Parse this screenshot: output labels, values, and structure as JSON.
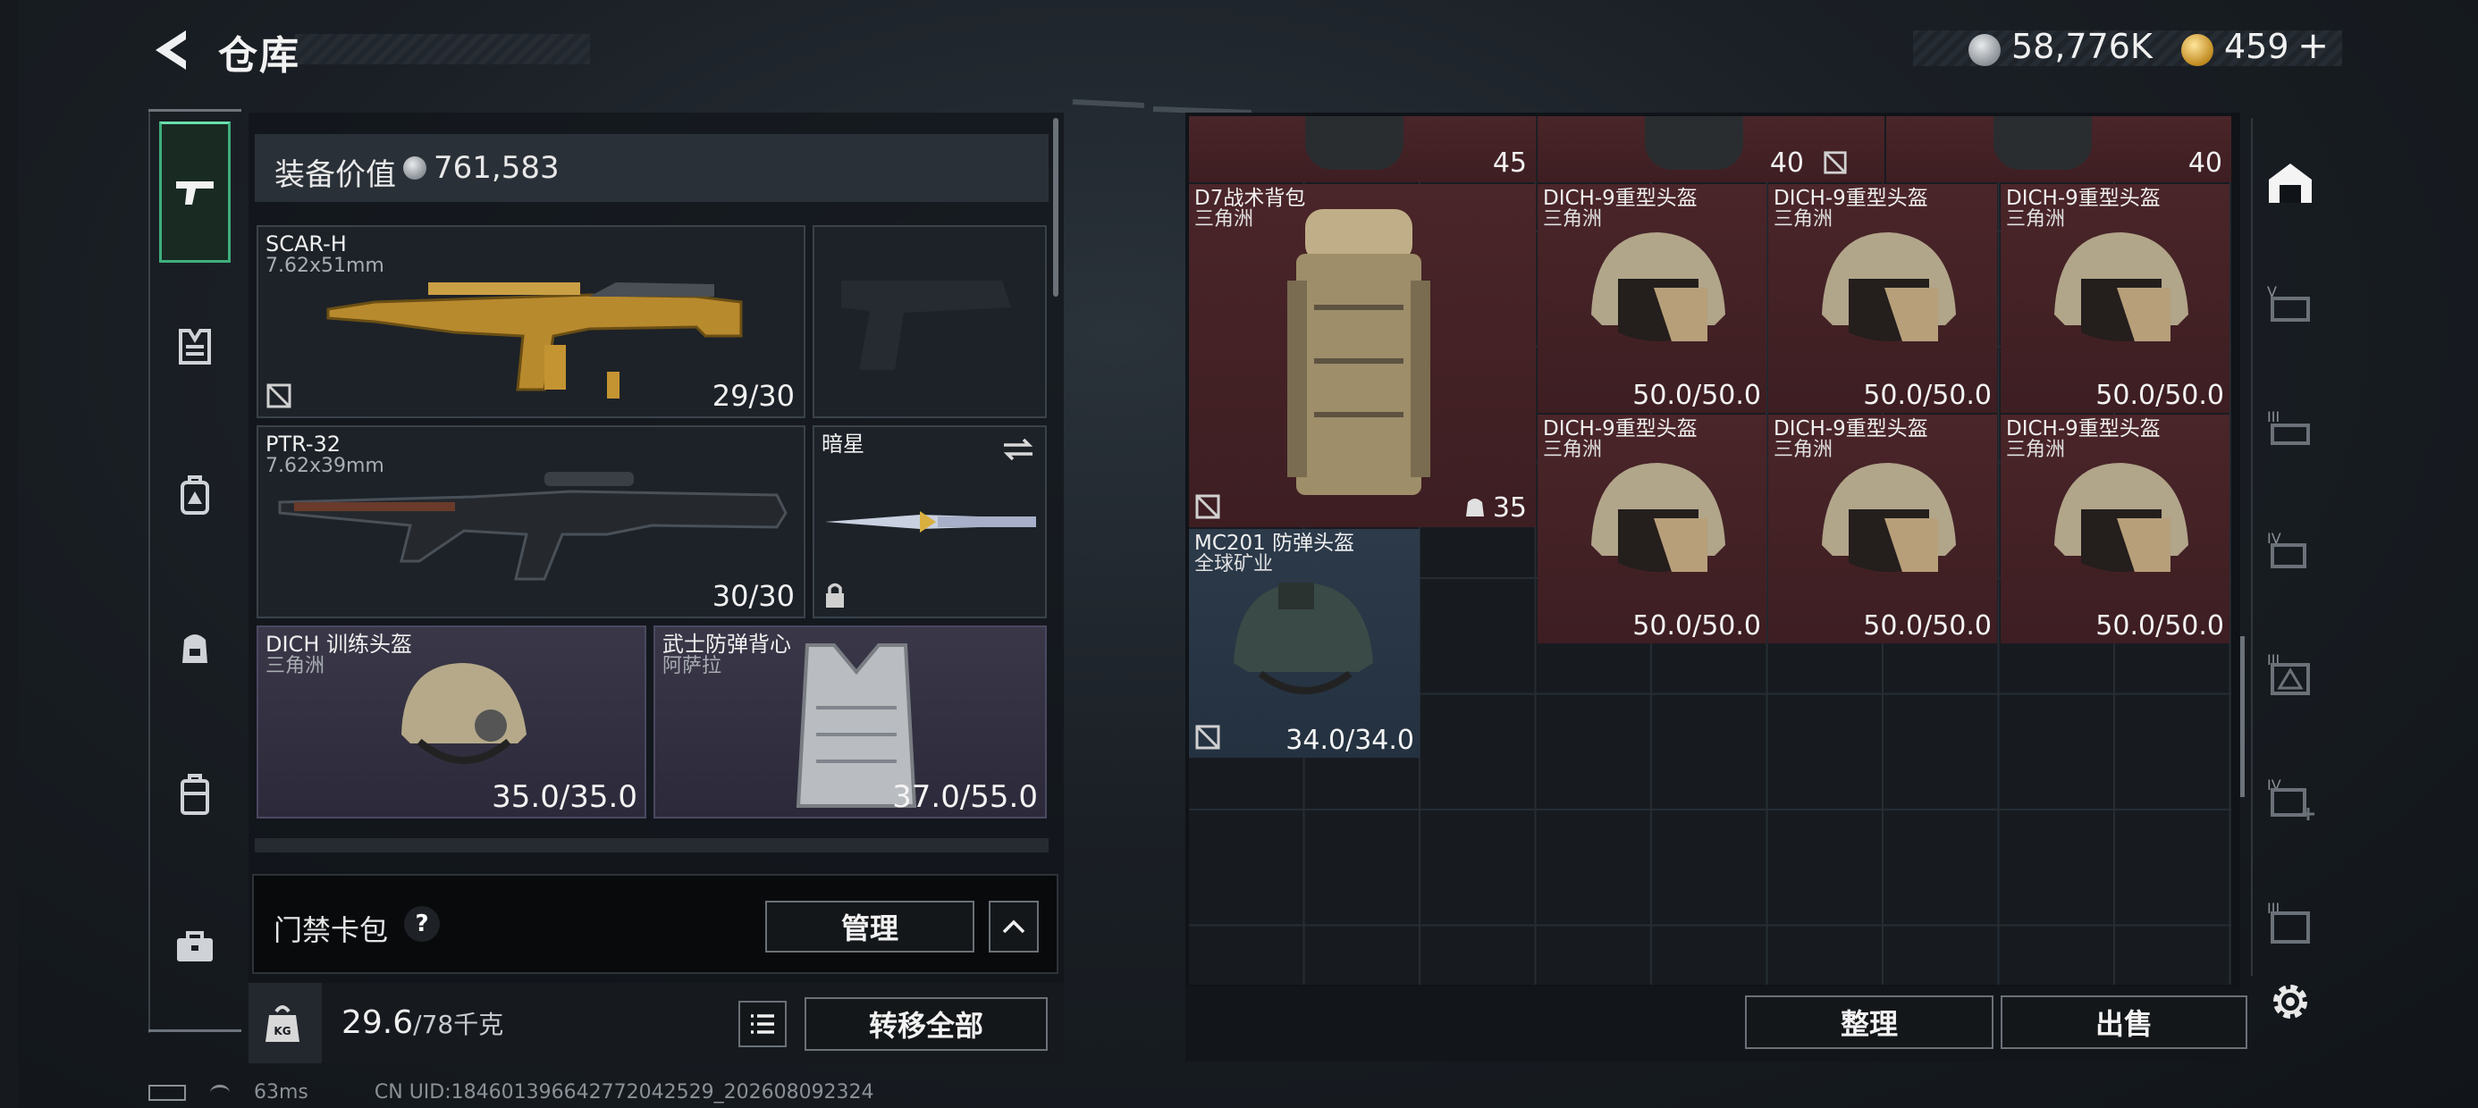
{
  "header": {
    "title": "仓库",
    "silver_amount": "58,776K",
    "gold_amount": "459",
    "gold_plus": "+"
  },
  "equipment": {
    "value_label": "装备价值",
    "value": "761,583",
    "primary_weapon": {
      "name": "SCAR-H",
      "caliber": "7.62x51mm",
      "ammo": "29/30"
    },
    "sidearm": {
      "name": "",
      "caliber": ""
    },
    "secondary_weapon": {
      "name": "PTR-32",
      "caliber": "7.62x39mm",
      "ammo": "30/30"
    },
    "melee": {
      "name": "暗星"
    },
    "helmet": {
      "name": "DICH 训练头盔",
      "sub": "三角洲",
      "durability": "35.0/35.0"
    },
    "armor": {
      "name": "武士防弹背心",
      "sub": "阿萨拉",
      "durability": "37.0/55.0"
    }
  },
  "keycard": {
    "label": "门禁卡包",
    "help": "?",
    "manage_label": "管理"
  },
  "footer_left": {
    "weight": "29.6",
    "weight_max": "/78千克",
    "transfer_all_label": "转移全部"
  },
  "stash": {
    "top_row_caps": [
      "45",
      "40",
      "40"
    ],
    "backpack": {
      "name": "D7战术背包",
      "sub": "三角洲",
      "capacity": "35"
    },
    "heavy_helmets": [
      {
        "name": "DICH-9重型头盔",
        "sub": "三角洲",
        "durability": "50.0/50.0"
      },
      {
        "name": "DICH-9重型头盔",
        "sub": "三角洲",
        "durability": "50.0/50.0"
      },
      {
        "name": "DICH-9重型头盔",
        "sub": "三角洲",
        "durability": "50.0/50.0"
      },
      {
        "name": "DICH-9重型头盔",
        "sub": "三角洲",
        "durability": "50.0/50.0"
      },
      {
        "name": "DICH-9重型头盔",
        "sub": "三角洲",
        "durability": "50.0/50.0"
      },
      {
        "name": "DICH-9重型头盔",
        "sub": "三角洲",
        "durability": "50.0/50.0"
      }
    ],
    "mc201": {
      "name": "MC201 防弹头盔",
      "sub": "全球矿业",
      "durability": "34.0/34.0"
    },
    "sort_label": "整理",
    "sell_label": "出售"
  },
  "status": {
    "ping": "63ms",
    "uid": "CN UID:184601396642772042529_202608092324"
  },
  "colors": {
    "accent_green": "#3fae7d",
    "item_red": "#4a2529",
    "item_blue": "#2c3a4a",
    "armor_purple": "#3a3748"
  }
}
